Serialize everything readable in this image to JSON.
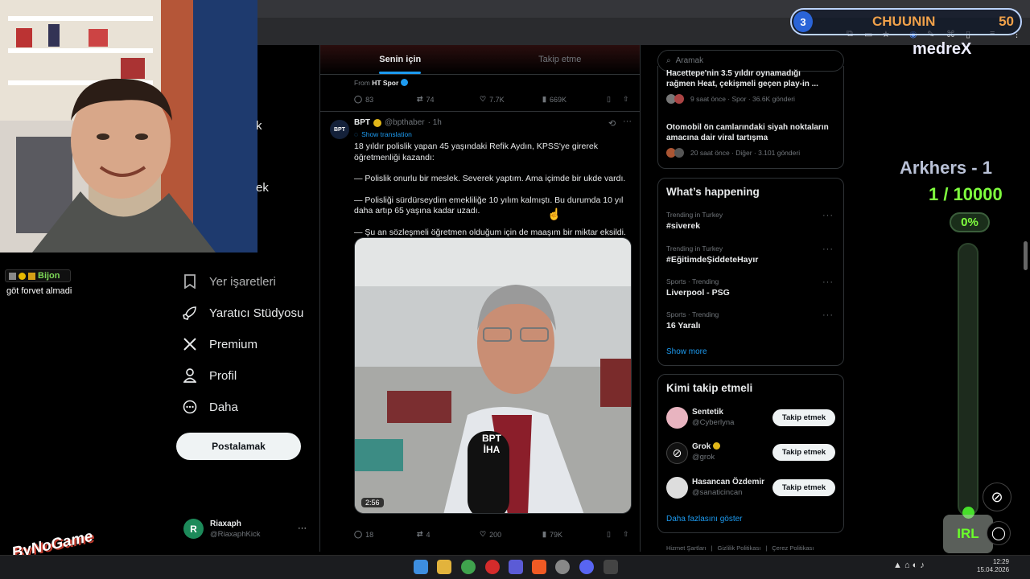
{
  "feed": {
    "tabs": [
      "Senin için",
      "Takip etme"
    ],
    "prev_tweet": {
      "from_label": "From",
      "from_name": "HT Spor",
      "replies": "83",
      "retweets": "74",
      "likes": "7.7K",
      "views": "669K"
    },
    "tweet": {
      "avatar_text": "BPT",
      "name": "BPT",
      "handle": "@bpthaber",
      "time": "· 1h",
      "translate": "Show translation",
      "paragraphs": [
        "18 yıldır polislik yapan 45 yaşındaki Refik Aydın, KPSS'ye girerek öğretmenliği kazandı:",
        "— Polislik onurlu bir meslek. Severek yaptım. Ama içimde bir ukde vardı.",
        "— Polisliği sürdürseydim emekliliğe 10 yılım kalmıştı. Bu durumda 10 yıl daha artıp 65 yaşına kadar uzadı.",
        "— Şu an sözleşmeli öğretmen olduğum için de maaşım bir miktar eksildi."
      ],
      "video_duration": "2:56",
      "video_watermark": "BPT İHA",
      "replies": "18",
      "retweets": "4",
      "likes": "200",
      "views": "79K"
    }
  },
  "left_nav": {
    "partial_top": "k",
    "partial_mid": "ek",
    "items": [
      {
        "label": "Yer işaretleri",
        "icon": "bookmark-icon"
      },
      {
        "label": "Yaratıcı Stüdyosu",
        "icon": "rocket-icon"
      },
      {
        "label": "Premium",
        "icon": "x-logo-icon"
      },
      {
        "label": "Profil",
        "icon": "person-icon"
      },
      {
        "label": "Daha",
        "icon": "more-circle-icon"
      }
    ],
    "post_button": "Postalamak",
    "account": {
      "initial": "R",
      "name": "Riaxaph",
      "handle": "@RiaxaphKick",
      "more": "···"
    }
  },
  "chat": {
    "username": "Bijon",
    "message": "göt forvet almadi"
  },
  "right": {
    "search_placeholder": "Aramak",
    "news_items": [
      {
        "title": "Hacettepe'nin 3.5 yıldır oynamadığı rağmen Heat, çekişmeli geçen play-in ...",
        "meta": "9 saat önce · Spor · 36.6K gönderi"
      },
      {
        "title": "Otomobil ön camlarındaki siyah noktaların amacına dair viral tartışma",
        "meta": "20 saat önce · Diğer · 3.101 gönderi"
      }
    ],
    "happening": {
      "title": "What’s happening",
      "trends": [
        {
          "meta": "Trending in Turkey",
          "name": "#siverek"
        },
        {
          "meta": "Trending in Turkey",
          "name": "#EğitimdeŞiddeteHayır"
        },
        {
          "meta": "Sports · Trending",
          "name": "Liverpool - PSG"
        },
        {
          "meta": "Sports · Trending",
          "name": "16 Yaralı"
        }
      ],
      "show_more": "Show more"
    },
    "who_to_follow": {
      "title": "Kimi takip etmeli",
      "accounts": [
        {
          "name": "Sentetik",
          "handle": "@Cyberlyna",
          "button": "Takip etmek"
        },
        {
          "name": "Grok",
          "handle": "@grok",
          "button": "Takip etmek"
        },
        {
          "name": "Hasancan Özdemir",
          "handle": "@sanaticincan",
          "button": "Takip etmek"
        }
      ],
      "show_more": "Daha fazlasını göster"
    },
    "footer": [
      "Hizmet Şartları",
      "Gizlilik Politikası",
      "Çerez Politikası"
    ]
  },
  "overlays": {
    "level": "3",
    "chuunin": "CHUUNIN",
    "chuunin_count": "50",
    "channel": "medreX",
    "arkhers": "Arkhers - 1",
    "goal": "1 / 10000",
    "progress": "0%",
    "progress_value": 0,
    "irl": "IRL",
    "brand": "ByNoGame"
  },
  "taskbar": {
    "time": "12:29",
    "date": "15.04.2026"
  }
}
